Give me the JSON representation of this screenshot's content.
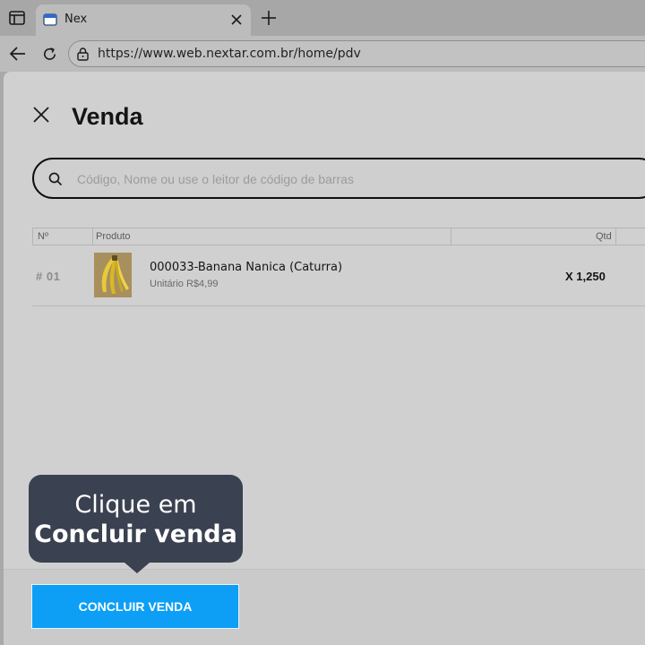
{
  "browser": {
    "tab_title": "Nex",
    "url": "https://www.web.nextar.com.br/home/pdv"
  },
  "icons": {
    "sidebar_toggle": "sidebar-toggle-icon",
    "favicon": "site-favicon",
    "tab_close": "close-icon",
    "new_tab": "plus-icon",
    "back": "arrow-left-icon",
    "reload": "reload-icon",
    "lock": "lock-icon",
    "close_sale": "close-icon",
    "search": "search-icon"
  },
  "sale": {
    "title": "Venda",
    "search_placeholder": "Código, Nome ou use o leitor de código de barras",
    "columns": {
      "number": "Nº",
      "product": "Produto",
      "qty": "Qtd"
    },
    "items": [
      {
        "number": "# 01",
        "name": "000033-Banana Nanica (Caturra)",
        "unit_price": "Unitário R$4,99",
        "qty": "X 1,250"
      }
    ],
    "conclude_button": "CONCLUIR VENDA"
  },
  "tooltip": {
    "line1": "Clique em",
    "line2": "Concluir venda"
  },
  "colors": {
    "primary": "#0d9ff5",
    "tooltip_bg": "#3a4150"
  }
}
